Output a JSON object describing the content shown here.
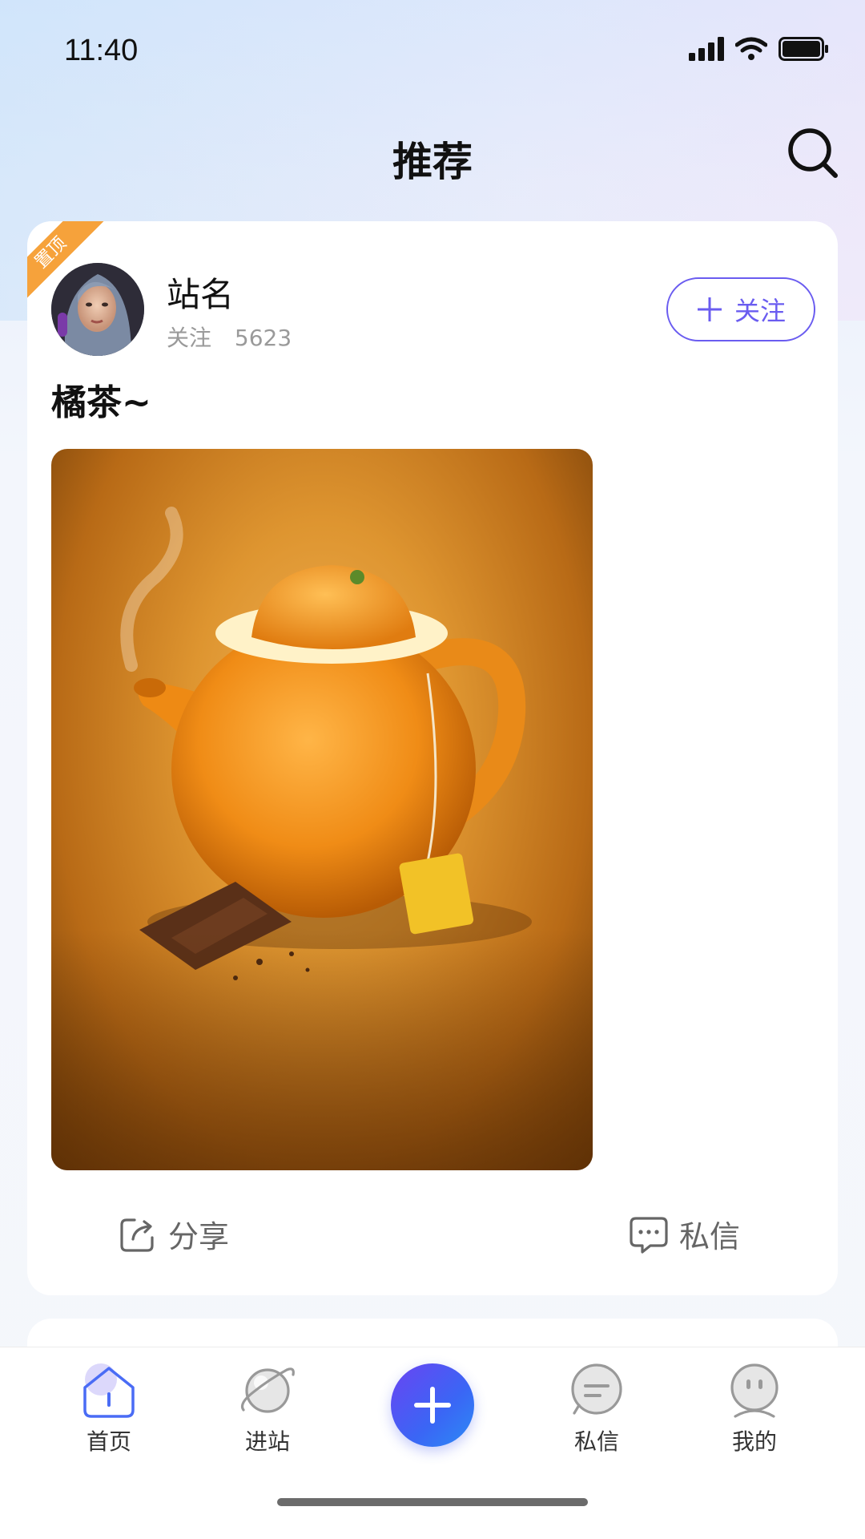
{
  "status_bar": {
    "time": "11:40"
  },
  "header": {
    "title": "推荐"
  },
  "post": {
    "pin_label": "置顶",
    "site_name": "站名",
    "follow_label": "关注",
    "follow_count": "5623",
    "follow_button": "关注",
    "title": "橘茶~",
    "share_label": "分享",
    "message_label": "私信"
  },
  "tabbar": {
    "home": "首页",
    "station": "进站",
    "messages": "私信",
    "me": "我的"
  },
  "colors": {
    "accent": "#6a5cf0",
    "pin": "#f6a23b",
    "add_button_start": "#6a44f2",
    "add_button_end": "#2c8bf5",
    "home_active": "#4a6cf5"
  }
}
